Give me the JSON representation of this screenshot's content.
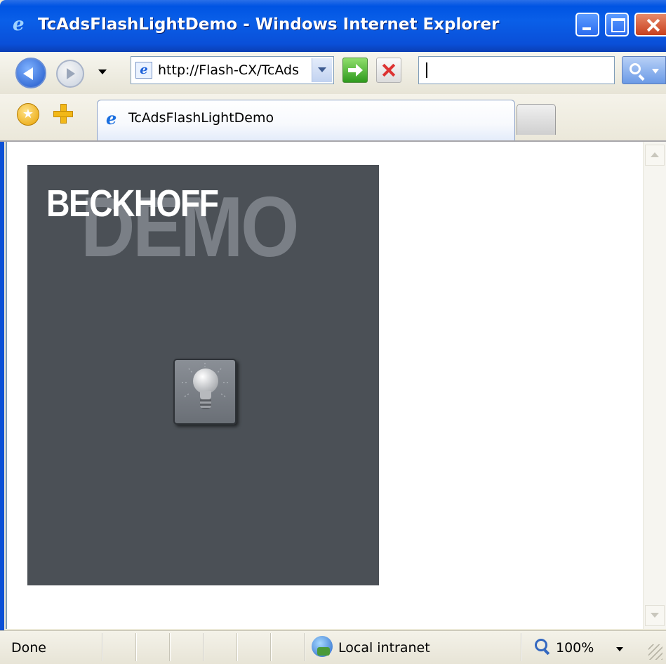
{
  "window": {
    "title": "TcAdsFlashLightDemo - Windows Internet Explorer"
  },
  "navbar": {
    "address": "http://Flash-CX/TcAds",
    "search_value": ""
  },
  "tabs": [
    {
      "label": "TcAdsFlashLightDemo"
    }
  ],
  "page": {
    "brand": "BECKHOFF",
    "watermark": "DEMO",
    "light_button_icon": "light-bulb-icon"
  },
  "statusbar": {
    "status": "Done",
    "zone": "Local intranet",
    "zoom": "100%"
  },
  "colors": {
    "titlebar": "#0054e3",
    "flash_background": "#4b5056",
    "watermark": "#7a7f86"
  }
}
